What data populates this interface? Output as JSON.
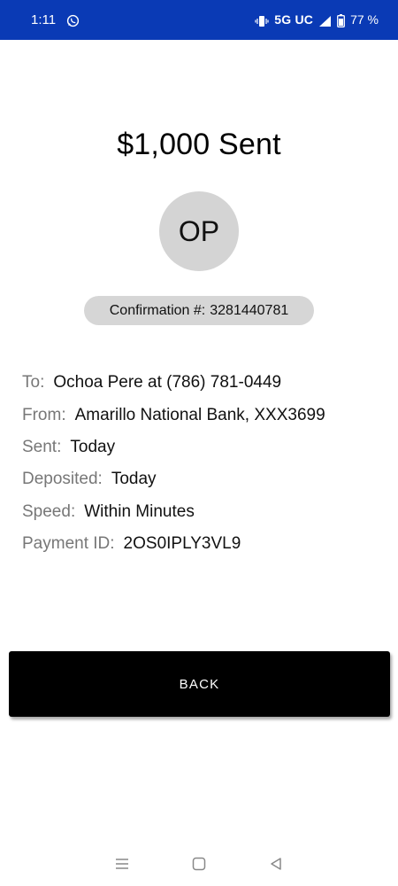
{
  "status_bar": {
    "time": "1:11",
    "network": "5G UC",
    "battery": "77 %",
    "icons": [
      "whatsapp-icon",
      "vibrate-icon",
      "signal-icon",
      "battery-icon"
    ]
  },
  "payment": {
    "title": "$1,000 Sent",
    "avatar_initials": "OP",
    "confirmation_label": "Confirmation #:",
    "confirmation_number": "3281440781"
  },
  "details": [
    {
      "label": "To:",
      "value": "Ochoa Pere at (786) 781-0449"
    },
    {
      "label": "From:",
      "value": "Amarillo National Bank, XXX3699"
    },
    {
      "label": "Sent:",
      "value": "Today"
    },
    {
      "label": "Deposited:",
      "value": "Today"
    },
    {
      "label": "Speed:",
      "value": "Within Minutes"
    },
    {
      "label": "Payment ID:",
      "value": "2OS0IPLY3VL9"
    }
  ],
  "actions": {
    "back_label": "BACK"
  },
  "nav_bar": {
    "icons": [
      "menu-icon",
      "home-icon",
      "back-nav-icon"
    ]
  },
  "colors": {
    "status_bar": "#0a3ab5",
    "avatar_bg": "#d4d4d4",
    "pill_bg": "#d6d6d6",
    "button_bg": "#000000",
    "label_gray": "#777777"
  }
}
